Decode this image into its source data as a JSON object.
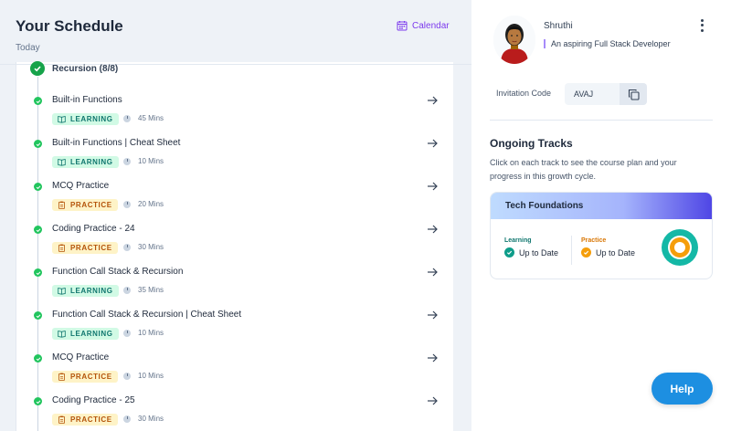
{
  "header": {
    "title": "Your Schedule",
    "subtitle": "Today",
    "calendar_label": "Calendar",
    "calendar_icon": "calendar-icon"
  },
  "topic": {
    "label": "Recursion (8/8)",
    "icon": "check-circle-icon"
  },
  "items": [
    {
      "name": "Built-in Functions",
      "tag": "LEARNING",
      "duration": "45 Mins"
    },
    {
      "name": "Built-in Functions | Cheat Sheet",
      "tag": "LEARNING",
      "duration": "10 Mins"
    },
    {
      "name": "MCQ Practice",
      "tag": "PRACTICE",
      "duration": "20 Mins"
    },
    {
      "name": "Coding Practice - 24",
      "tag": "PRACTICE",
      "duration": "30 Mins"
    },
    {
      "name": "Function Call Stack & Recursion",
      "tag": "LEARNING",
      "duration": "35 Mins"
    },
    {
      "name": "Function Call Stack & Recursion | Cheat Sheet",
      "tag": "LEARNING",
      "duration": "10 Mins"
    },
    {
      "name": "MCQ Practice",
      "tag": "PRACTICE",
      "duration": "10 Mins"
    },
    {
      "name": "Coding Practice - 25",
      "tag": "PRACTICE",
      "duration": "30 Mins"
    }
  ],
  "profile": {
    "name": "Shruthi",
    "bio": "An aspiring Full Stack Developer",
    "menu_icon": "kebab-menu-icon"
  },
  "invitation": {
    "label": "Invitation Code",
    "code": "AVAJ",
    "copy_icon": "copy-icon"
  },
  "tracks": {
    "title": "Ongoing Tracks",
    "description": "Click on each track to see the course plan and your progress in this growth cycle.",
    "card": {
      "name": "Tech Foundations",
      "learning_label": "Learning",
      "learning_status": "Up to Date",
      "practice_label": "Practice",
      "practice_status": "Up to Date"
    }
  },
  "help_label": "Help",
  "colors": {
    "accent": "#7c3aed",
    "success": "#16a34a",
    "learning": "#0f766e",
    "practice": "#d97706",
    "help": "#1d8fe1"
  }
}
